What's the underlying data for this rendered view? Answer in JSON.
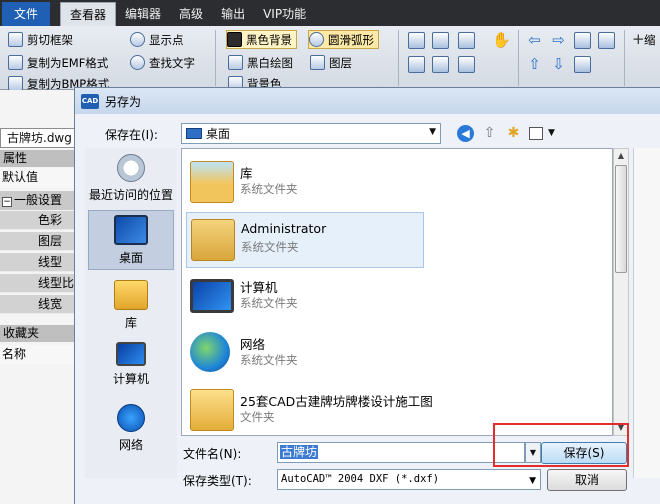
{
  "ribbon_tabs": [
    "文件",
    "查看器",
    "编辑器",
    "高级",
    "输出",
    "VIP功能"
  ],
  "ribbon_active_tab": "查看器",
  "ribbon": {
    "g1": [
      "剪切框架",
      "复制为EMF格式",
      "复制为BMP格式"
    ],
    "g2": [
      "显示点",
      "查找文字"
    ],
    "g3": [
      "黑色背景",
      "圆滑弧形",
      "黑白绘图",
      "图层",
      "背景色"
    ],
    "g5": [
      "缩"
    ]
  },
  "left_panel": {
    "doc_tab": "古牌坊.dwg",
    "properties_header": "属性",
    "defaults": "默认值",
    "group": "一般设置",
    "props": [
      "色彩",
      "图层",
      "线型",
      "线型比",
      "线宽"
    ],
    "favorites_header": "收藏夹",
    "name_col": "名称"
  },
  "dialog": {
    "title": "另存为",
    "logo": "CAD",
    "look_in_label": "保存在(I):",
    "look_in_value": "桌面",
    "places": [
      {
        "label": "最近访问的位置",
        "icon": "recent-places-icon"
      },
      {
        "label": "桌面",
        "icon": "desktop-icon"
      },
      {
        "label": "库",
        "icon": "libraries-icon"
      },
      {
        "label": "计算机",
        "icon": "computer-icon"
      },
      {
        "label": "网络",
        "icon": "network-icon"
      }
    ],
    "selected_place": "桌面",
    "files": [
      {
        "name": "库",
        "type": "系统文件夹"
      },
      {
        "name": "Administrator",
        "type": "系统文件夹"
      },
      {
        "name": "计算机",
        "type": "系统文件夹"
      },
      {
        "name": "网络",
        "type": "系统文件夹"
      },
      {
        "name": "25套CAD古建牌坊牌楼设计施工图",
        "type": "文件夹"
      }
    ],
    "selected_file": "Administrator",
    "filename_label": "文件名(N):",
    "filename_value": "古牌坊",
    "filetype_label": "保存类型(T):",
    "filetype_value": "AutoCAD™ 2004 DXF (*.dxf)",
    "save_button": "保存(S)",
    "cancel_button": "取消"
  },
  "colors": {
    "file_tab": "#1f5fb4",
    "annotation": "#e22d2d",
    "selection": "#3b7bd3"
  }
}
